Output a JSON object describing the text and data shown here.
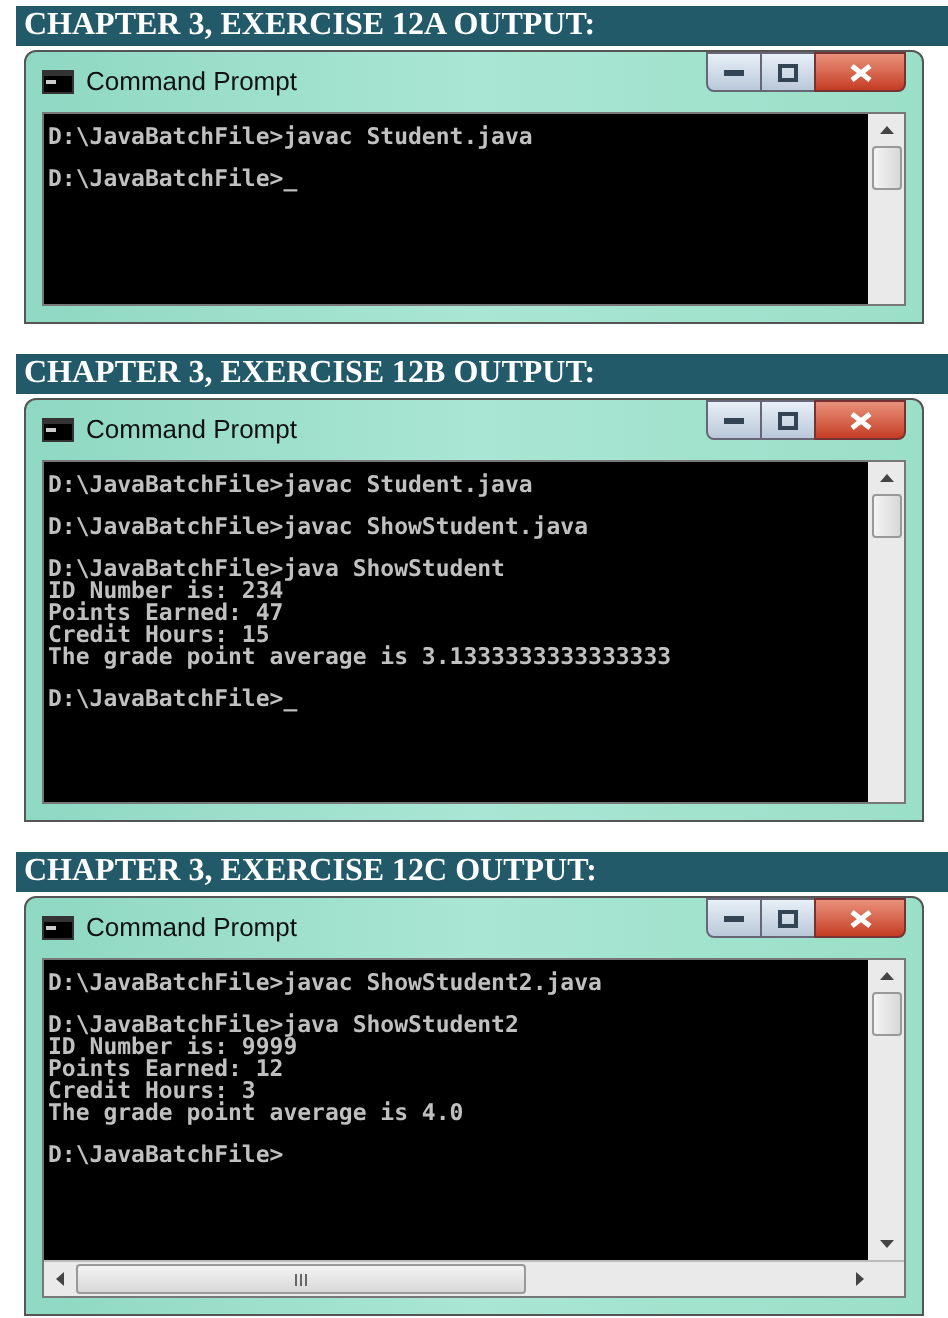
{
  "sections": [
    {
      "heading": "CHAPTER 3, EXERCISE 12A OUTPUT:",
      "window": {
        "title": "Command Prompt",
        "horizontal_scrollbar": false,
        "blocks": [
          [
            "D:\\JavaBatchFile>javac Student.java"
          ],
          [
            "D:\\JavaBatchFile>_"
          ]
        ]
      }
    },
    {
      "heading": "CHAPTER 3, EXERCISE 12B OUTPUT:",
      "window": {
        "title": "Command Prompt",
        "horizontal_scrollbar": false,
        "blocks": [
          [
            "D:\\JavaBatchFile>javac Student.java"
          ],
          [
            "D:\\JavaBatchFile>javac ShowStudent.java"
          ],
          [
            "D:\\JavaBatchFile>java ShowStudent",
            "ID Number is: 234",
            "Points Earned: 47",
            "Credit Hours: 15",
            "The grade point average is 3.1333333333333333"
          ],
          [
            "D:\\JavaBatchFile>_"
          ]
        ]
      }
    },
    {
      "heading": "CHAPTER 3, EXERCISE 12C OUTPUT:",
      "window": {
        "title": "Command Prompt",
        "horizontal_scrollbar": true,
        "blocks": [
          [
            "D:\\JavaBatchFile>javac ShowStudent2.java"
          ],
          [
            "D:\\JavaBatchFile>java ShowStudent2",
            "ID Number is: 9999",
            "Points Earned: 12",
            "Credit Hours: 3",
            "The grade point average is 4.0"
          ],
          [
            "D:\\JavaBatchFile>"
          ]
        ]
      }
    }
  ]
}
